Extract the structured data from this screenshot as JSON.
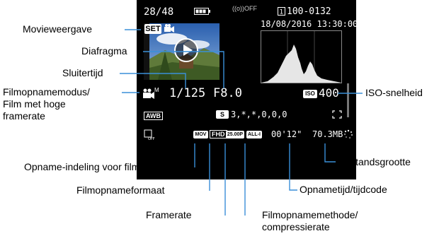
{
  "screen": {
    "image_counter": "28/48",
    "folder_file": "100-0132",
    "datetime": "18/08/2016 13:30:00",
    "wifi_status": "((o))OFF",
    "set_badge": "SET",
    "shutter": "1/125",
    "aperture": "F8.0",
    "iso_badge": "ISO",
    "iso": "400",
    "awb": "AWB",
    "picture_style_badge": "S",
    "picture_style_values": "3,*,*,0,0,0",
    "format_mov": "MOV",
    "format_fhd": "FHD",
    "framerate": "25.00P",
    "compression": "ALL-I",
    "rec_time": "00'12\"",
    "file_size": "70.3MB",
    "movie_mode": "M"
  },
  "labels": {
    "movieweergave": "Movieweergave",
    "diafragma": "Diafragma",
    "sluitertijd": "Sluitertijd",
    "filmopnamemodus_1": "Filmopnamemodus/",
    "filmopnamemodus_2": "Film met hoge",
    "filmopnamemodus_3": "framerate",
    "iso_snelheid": "ISO-snelheid",
    "opname_indeling": "Opname-indeling voor films",
    "filmopnameformaat": "Filmopnameformaat",
    "framerate": "Framerate",
    "bestandsgrootte": "Bestandsgrootte",
    "opnametijd": "Opnametijd/tijdcode",
    "filmopnamemethode_1": "Filmopnamemethode/",
    "filmopnamemethode_2": "compressierate"
  },
  "colors": {
    "screen_bg": "#000000",
    "text": "#ffffff",
    "leader_line": "#3a8fd8"
  }
}
